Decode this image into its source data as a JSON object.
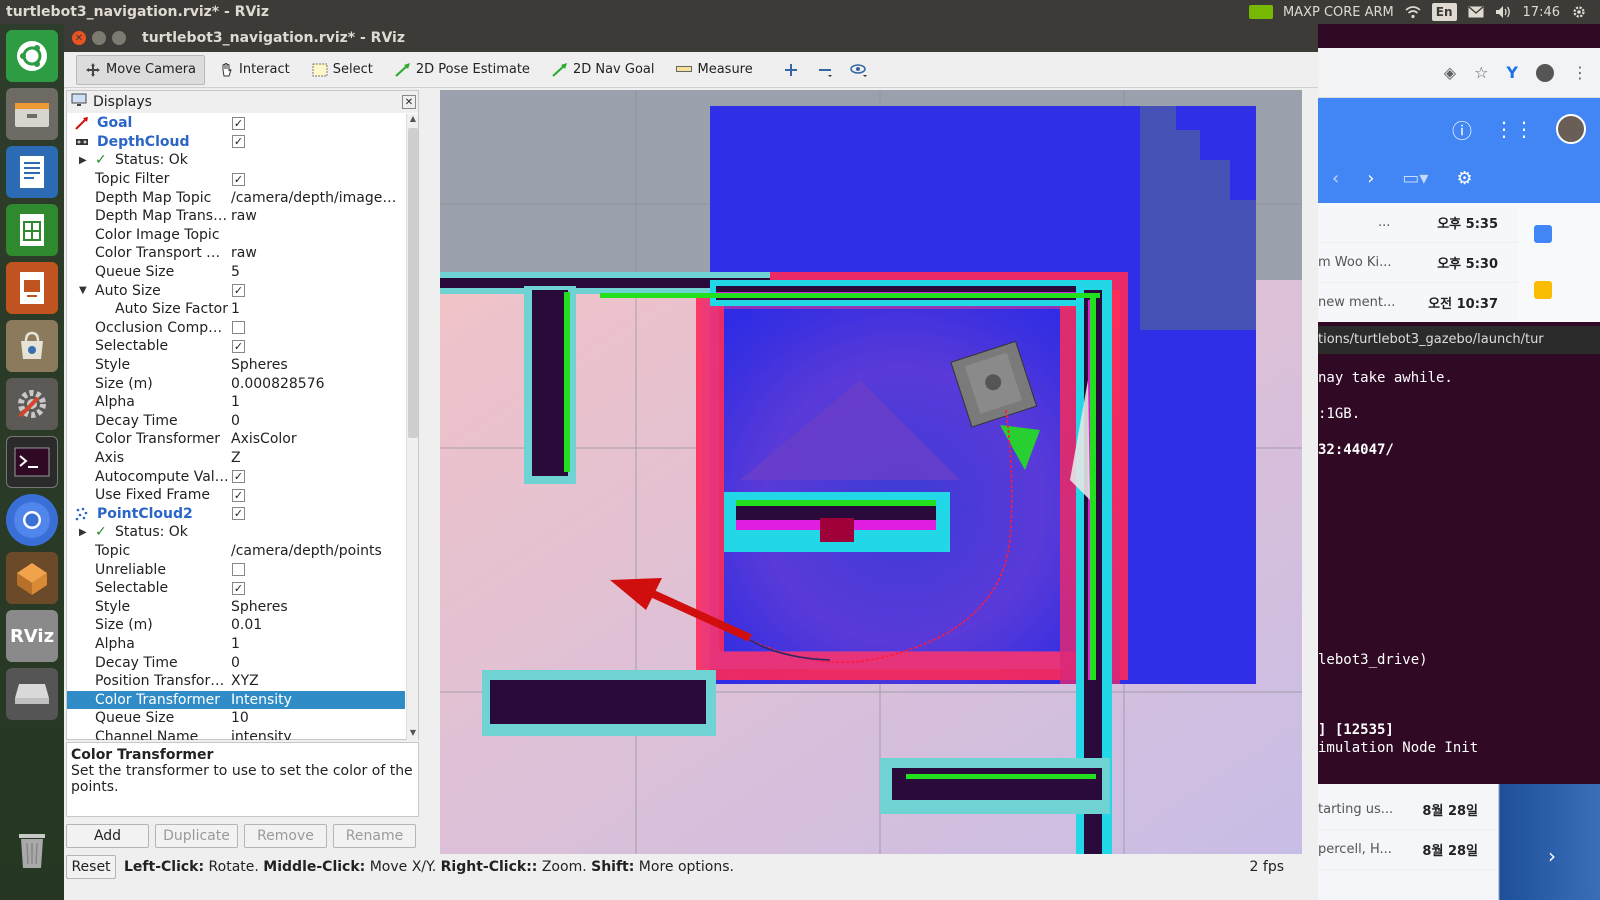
{
  "topbar": {
    "window_title": "turtlebot3_navigation.rviz* - RViz",
    "gpu_label": "MAXP CORE ARM",
    "lang": "En",
    "time": "17:46"
  },
  "launcher": {
    "items": [
      "ubuntu-home",
      "files",
      "writer",
      "calc",
      "impress",
      "software",
      "settings",
      "terminal",
      "chromium",
      "virtualbox",
      "rviz",
      "drive",
      "trash"
    ],
    "rviz_label": "RViz"
  },
  "rviz": {
    "title": "turtlebot3_navigation.rviz* - RViz",
    "toolbar": {
      "move_camera": "Move Camera",
      "interact": "Interact",
      "select": "Select",
      "pose_estimate": "2D Pose Estimate",
      "nav_goal": "2D Nav Goal",
      "measure": "Measure"
    },
    "displays": {
      "title": "Displays",
      "rows": [
        {
          "name": "Goal",
          "kind": "display",
          "value": "",
          "checked": true
        },
        {
          "name": "DepthCloud",
          "kind": "display",
          "value": "",
          "checked": true
        },
        {
          "name": "Status: Ok",
          "kind": "status",
          "value": ""
        },
        {
          "name": "Topic Filter",
          "value": "",
          "checked": true
        },
        {
          "name": "Depth Map Topic",
          "value": "/camera/depth/image_…"
        },
        {
          "name": "Depth Map Trans…",
          "value": "raw"
        },
        {
          "name": "Color Image Topic",
          "value": ""
        },
        {
          "name": "Color Transport …",
          "value": "raw"
        },
        {
          "name": "Queue Size",
          "value": "5"
        },
        {
          "name": "Auto Size",
          "value": "",
          "checked": true,
          "expanded": true
        },
        {
          "name": "Auto Size Factor",
          "value": "1",
          "indent": 2
        },
        {
          "name": "Occlusion Compe…",
          "value": "",
          "checked": false
        },
        {
          "name": "Selectable",
          "value": "",
          "checked": true
        },
        {
          "name": "Style",
          "value": "Spheres"
        },
        {
          "name": "Size (m)",
          "value": "0.000828576"
        },
        {
          "name": "Alpha",
          "value": "1"
        },
        {
          "name": "Decay Time",
          "value": "0"
        },
        {
          "name": "Color Transformer",
          "value": "AxisColor"
        },
        {
          "name": "Axis",
          "value": "Z"
        },
        {
          "name": "Autocompute Val…",
          "value": "",
          "checked": true
        },
        {
          "name": "Use Fixed Frame",
          "value": "",
          "checked": true
        },
        {
          "name": "PointCloud2",
          "kind": "display",
          "value": "",
          "checked": true
        },
        {
          "name": "Status: Ok",
          "kind": "status",
          "value": ""
        },
        {
          "name": "Topic",
          "value": "/camera/depth/points"
        },
        {
          "name": "Unreliable",
          "value": "",
          "checked": false
        },
        {
          "name": "Selectable",
          "value": "",
          "checked": true
        },
        {
          "name": "Style",
          "value": "Spheres"
        },
        {
          "name": "Size (m)",
          "value": "0.01"
        },
        {
          "name": "Alpha",
          "value": "1"
        },
        {
          "name": "Decay Time",
          "value": "0"
        },
        {
          "name": "Position Transfor…",
          "value": "XYZ"
        },
        {
          "name": "Color Transformer",
          "value": "Intensity",
          "selected": true
        },
        {
          "name": "Queue Size",
          "value": "10"
        },
        {
          "name": "Channel Name",
          "value": "intensity"
        }
      ]
    },
    "description": {
      "title": "Color Transformer",
      "text": "Set the transformer to use to set the color of the points."
    },
    "buttons": {
      "add": "Add",
      "duplicate": "Duplicate",
      "remove": "Remove",
      "rename": "Rename"
    },
    "status": {
      "reset": "Reset",
      "left_click": "Left-Click:",
      "left_action": "Rotate.",
      "middle_click": "Middle-Click:",
      "middle_action": "Move X/Y.",
      "right_click": "Right-Click::",
      "right_action": "Zoom.",
      "shift": "Shift:",
      "shift_action": "More options.",
      "fps": "2 fps"
    }
  },
  "background": {
    "mail_rows": [
      {
        "snippet": "...",
        "date": "오후 5:35"
      },
      {
        "snippet": "m Woo Ki...",
        "date": "오후 5:30"
      },
      {
        "snippet": "new ment...",
        "date": "오전 10:37"
      }
    ],
    "mail_rows_bottom": [
      {
        "snippet": "tarting us...",
        "date": "8월 28일"
      },
      {
        "snippet": "percell, H...",
        "date": "8월 28일"
      }
    ],
    "terminal": {
      "path": "tions/turtlebot3_gazebo/launch/tur",
      "lines": [
        "nay take awhile.",
        ":1GB.",
        "32:44047/",
        "lebot3_drive)",
        "] [12535]",
        "imulation Node Init"
      ]
    }
  }
}
